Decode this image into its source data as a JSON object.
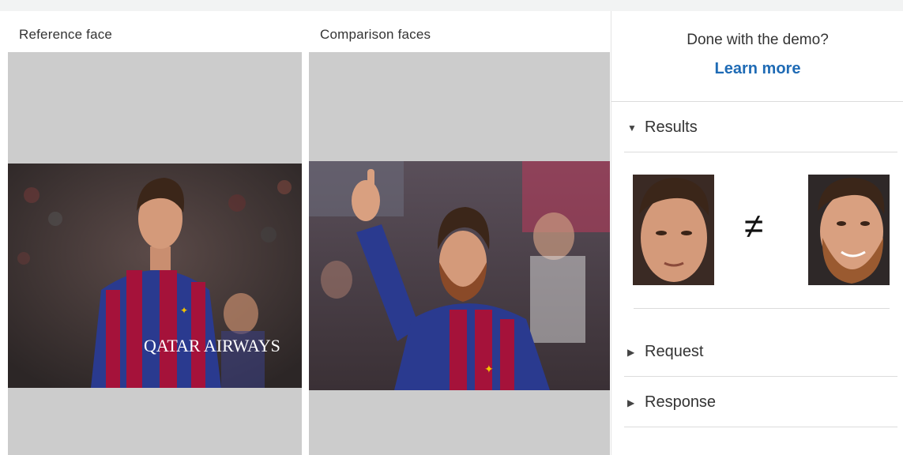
{
  "reference": {
    "title": "Reference face",
    "jersey_text": "QATAR AIRWAYS"
  },
  "comparison": {
    "title": "Comparison faces"
  },
  "sidebar": {
    "done_text": "Done with the demo?",
    "learn_more": "Learn more",
    "sections": [
      {
        "label": "Results",
        "expanded": true
      },
      {
        "label": "Request",
        "expanded": false
      },
      {
        "label": "Response",
        "expanded": false
      }
    ],
    "match_symbol": "≠"
  },
  "colors": {
    "link": "#1f6bb5",
    "placeholder": "#cccccc",
    "jersey_blue": "#2a3a8f",
    "jersey_red": "#a5123a"
  }
}
